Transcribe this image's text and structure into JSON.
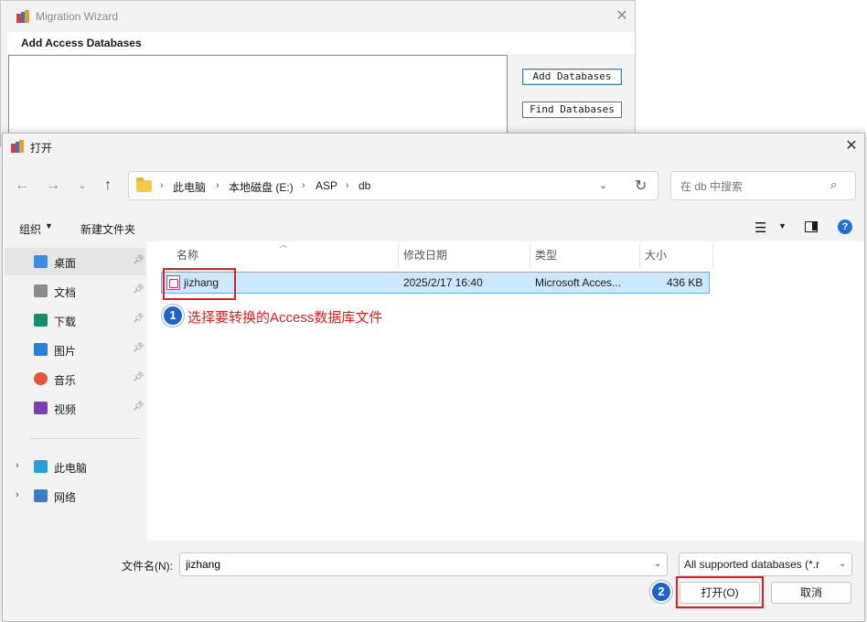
{
  "wizard": {
    "title": "Migration Wizard",
    "subtitle": "Add Access Databases",
    "add_button": "Add Databases",
    "find_button": "Find Databases"
  },
  "dialog": {
    "title": "打开",
    "breadcrumb": [
      "此电脑",
      "本地磁盘 (E:)",
      "ASP",
      "db"
    ],
    "search_placeholder": "在 db 中搜索",
    "toolbar": {
      "organize": "组织",
      "new_folder": "新建文件夹"
    },
    "nav": {
      "quick_access": [
        {
          "label": "桌面",
          "icon": "desktop-icon",
          "color": "#3a8de0"
        },
        {
          "label": "文档",
          "icon": "document-icon",
          "color": "#8a8a8a"
        },
        {
          "label": "下载",
          "icon": "download-icon",
          "color": "#1a8c6e"
        },
        {
          "label": "图片",
          "icon": "pictures-icon",
          "color": "#2b7fd6"
        },
        {
          "label": "音乐",
          "icon": "music-icon",
          "color": "#e2553e"
        },
        {
          "label": "视频",
          "icon": "videos-icon",
          "color": "#7b3fb0"
        }
      ],
      "this_pc": "此电脑",
      "network": "网络"
    },
    "columns": {
      "name": "名称",
      "modified": "修改日期",
      "type": "类型",
      "size": "大小"
    },
    "files": [
      {
        "name": "jizhang",
        "modified": "2025/2/17 16:40",
        "type": "Microsoft Access",
        "type_display": "Microsoft Acces...",
        "size": "436 KB"
      }
    ],
    "filename_label": "文件名(N):",
    "filename_value": "jizhang",
    "filter": "All supported databases (*.r",
    "open_button": "打开(O)",
    "cancel_button": "取消"
  },
  "annotations": {
    "step1_number": "1",
    "step1_text": "选择要转换的Access数据库文件",
    "step2_number": "2",
    "highlight_color": "#e02020"
  }
}
